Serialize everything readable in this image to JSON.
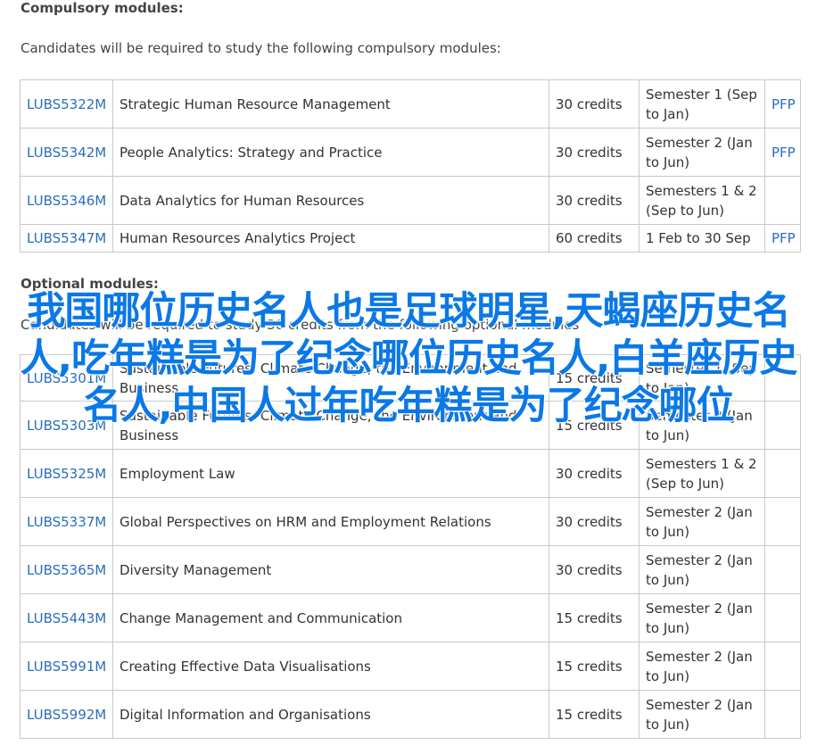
{
  "compulsory": {
    "heading": "Compulsory modules:",
    "intro": "Candidates will be required to study the following compulsory modules:",
    "rows": [
      {
        "code": "LUBS5322M",
        "title": "Strategic Human Resource Management",
        "credits": "30 credits",
        "semester": "Semester 1 (Sep to Jan)",
        "pfp": "PFP"
      },
      {
        "code": "LUBS5342M",
        "title": "People Analytics: Strategy and Practice",
        "credits": "30 credits",
        "semester": "Semester 2 (Jan to Jun)",
        "pfp": "PFP"
      },
      {
        "code": "LUBS5346M",
        "title": "Data Analytics for Human Resources",
        "credits": "30 credits",
        "semester": "Semesters 1 & 2 (Sep to Jun)",
        "pfp": ""
      },
      {
        "code": "LUBS5347M",
        "title": "Human Resources Analytics Project",
        "credits": "60 credits",
        "semester": "1 Feb to 30 Sep",
        "pfp": "PFP"
      }
    ]
  },
  "optional": {
    "heading": "Optional modules:",
    "intro": "Candidates will be required to study 30 credits from the following optional modules",
    "rows": [
      {
        "code": "LUBS5301M",
        "title": "Sustainable Futures: Climate Change, the Environment and Business",
        "credits": "15 credits",
        "semester": "Semester 1 (Sep to Jan)"
      },
      {
        "code": "LUBS5303M",
        "title": "Sustainable Futures: Climate Change, the Environment and Business",
        "credits": "15 credits",
        "semester": "Semester 2 (Jan to Jun)"
      },
      {
        "code": "LUBS5325M",
        "title": "Employment Law",
        "credits": "30 credits",
        "semester": "Semesters 1 & 2 (Sep to Jun)"
      },
      {
        "code": "LUBS5337M",
        "title": "Global Perspectives on HRM and Employment Relations",
        "credits": "30 credits",
        "semester": "Semester 2 (Jan to Jun)"
      },
      {
        "code": "LUBS5365M",
        "title": "Diversity Management",
        "credits": "30 credits",
        "semester": "Semester 2 (Jan to Jun)"
      },
      {
        "code": "LUBS5443M",
        "title": "Change Management and Communication",
        "credits": "15 credits",
        "semester": "Semester 2 (Jan to Jun)"
      },
      {
        "code": "LUBS5991M",
        "title": "Creating Effective Data Visualisations",
        "credits": "15 credits",
        "semester": "Semester 2 (Jan to Jun)"
      },
      {
        "code": "LUBS5992M",
        "title": "Digital Information and Organisations",
        "credits": "15 credits",
        "semester": "Semester 2 (Jan to Jun)"
      }
    ]
  },
  "overlay_text": "我国哪位历史名人也是足球明星,天蝎座历史名人,吃年糕是为了纪念哪位历史名人,白羊座历史名人,中国人过年吃年糕是为了纪念哪位",
  "colors": {
    "link": "#2a6ebb",
    "overlay_text": "#0a78e6",
    "border": "#c8c8c8"
  }
}
